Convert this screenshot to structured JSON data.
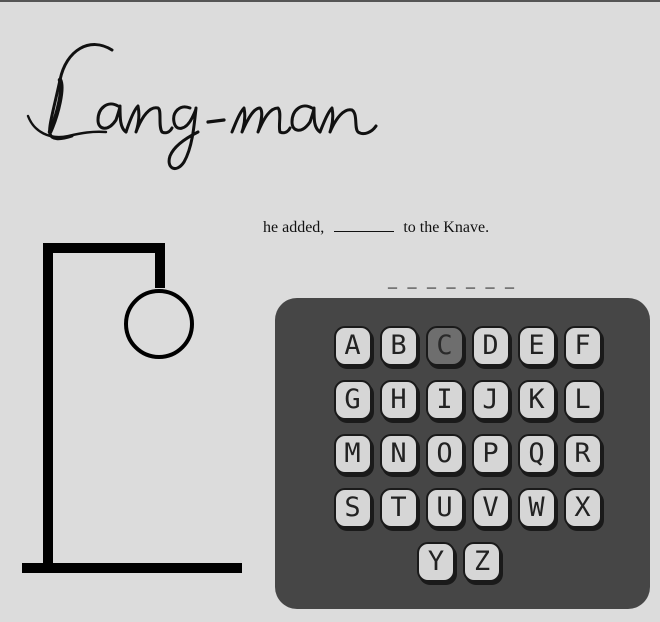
{
  "logo": {
    "text": "Lang-man"
  },
  "clue": {
    "before": "he added,",
    "after": "to the Knave."
  },
  "word": {
    "display": "_ _ _ _ _ _ _"
  },
  "game": {
    "wrong_guesses": 1,
    "drawn_parts": [
      "head"
    ]
  },
  "keyboard": {
    "rows": [
      [
        {
          "letter": "A",
          "used": false
        },
        {
          "letter": "B",
          "used": false
        },
        {
          "letter": "C",
          "used": true
        },
        {
          "letter": "D",
          "used": false
        },
        {
          "letter": "E",
          "used": false
        },
        {
          "letter": "F",
          "used": false
        }
      ],
      [
        {
          "letter": "G",
          "used": false
        },
        {
          "letter": "H",
          "used": false
        },
        {
          "letter": "I",
          "used": false
        },
        {
          "letter": "J",
          "used": false
        },
        {
          "letter": "K",
          "used": false
        },
        {
          "letter": "L",
          "used": false
        }
      ],
      [
        {
          "letter": "M",
          "used": false
        },
        {
          "letter": "N",
          "used": false
        },
        {
          "letter": "O",
          "used": false
        },
        {
          "letter": "P",
          "used": false
        },
        {
          "letter": "Q",
          "used": false
        },
        {
          "letter": "R",
          "used": false
        }
      ],
      [
        {
          "letter": "S",
          "used": false
        },
        {
          "letter": "T",
          "used": false
        },
        {
          "letter": "U",
          "used": false
        },
        {
          "letter": "V",
          "used": false
        },
        {
          "letter": "W",
          "used": false
        },
        {
          "letter": "X",
          "used": false
        }
      ],
      [
        {
          "letter": "Y",
          "used": false
        },
        {
          "letter": "Z",
          "used": false
        }
      ]
    ]
  }
}
